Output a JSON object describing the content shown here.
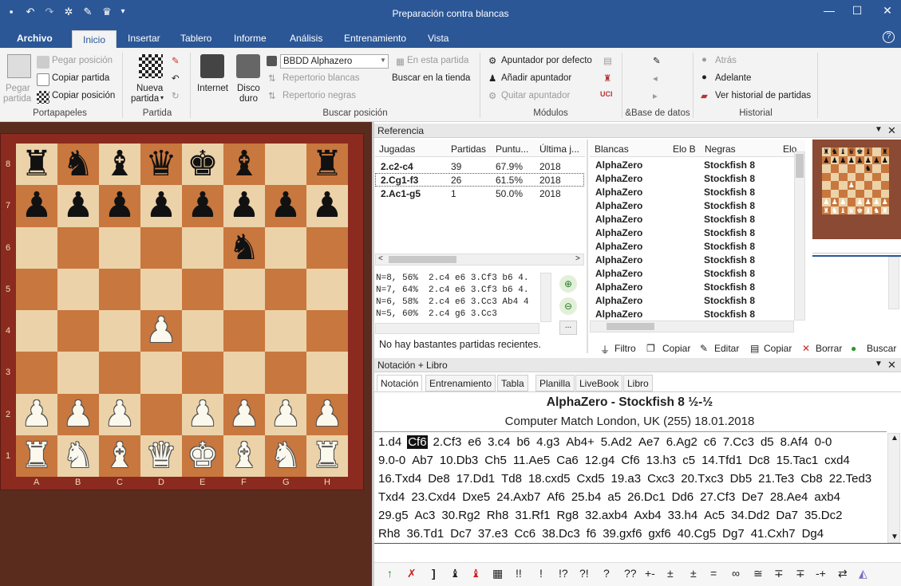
{
  "window": {
    "title": "Preparación contra blancas"
  },
  "menu": {
    "tabs": [
      "Archivo",
      "Inicio",
      "Insertar",
      "Tablero",
      "Informe",
      "Análisis",
      "Entrenamiento",
      "Vista"
    ],
    "active": "Inicio"
  },
  "ribbon": {
    "portapapeles": {
      "paste_big": "Pegar",
      "paste_big2": "partida",
      "paste_pos": "Pegar posición",
      "copy_game": "Copiar partida",
      "copy_pos": "Copiar posición",
      "group": "Portapapeles"
    },
    "partida": {
      "new_game": "Nueva",
      "new_game2": "partida",
      "group": "Partida"
    },
    "buscar": {
      "internet": "Internet",
      "disk": "Disco",
      "disk2": "duro",
      "db_select": "BBDD Alphazero",
      "rep_white": "Repertorio blancas",
      "rep_black": "Repertorio negras",
      "in_game": "En esta partida",
      "shop": "Buscar en la tienda",
      "group": "Buscar posición"
    },
    "modulos": {
      "default_engine": "Apuntador por defecto",
      "add_engine": "Añadir apuntador",
      "remove_engine": "Quitar apuntador",
      "group": "Módulos"
    },
    "base": {
      "group": "&Base de datos"
    },
    "historial": {
      "back": "Atrás",
      "forward": "Adelante",
      "history": "Ver historial de partidas",
      "group": "Historial"
    }
  },
  "board": {
    "files": [
      "A",
      "B",
      "C",
      "D",
      "E",
      "F",
      "G",
      "H"
    ],
    "ranks": [
      "8",
      "7",
      "6",
      "5",
      "4",
      "3",
      "2",
      "1"
    ],
    "position": [
      [
        "br",
        "bn",
        "bb",
        "bq",
        "bk",
        "bb",
        "",
        "br"
      ],
      [
        "bp",
        "bp",
        "bp",
        "bp",
        "bp",
        "bp",
        "bp",
        "bp"
      ],
      [
        "",
        "",
        "",
        "",
        "",
        "bn",
        "",
        ""
      ],
      [
        "",
        "",
        "",
        "",
        "",
        "",
        "",
        ""
      ],
      [
        "",
        "",
        "",
        "wp",
        "",
        "",
        "",
        ""
      ],
      [
        "",
        "",
        "",
        "",
        "",
        "",
        "",
        ""
      ],
      [
        "wp",
        "wp",
        "wp",
        "",
        "wp",
        "wp",
        "wp",
        "wp"
      ],
      [
        "wr",
        "wn",
        "wb",
        "wq",
        "wk",
        "wb",
        "wn",
        "wr"
      ]
    ]
  },
  "reference": {
    "title": "Referencia",
    "moves_headers": [
      "Jugadas",
      "Partidas",
      "Puntu...",
      "Última j..."
    ],
    "moves": [
      {
        "move": "2.c2-c4",
        "games": "39",
        "score": "67.9%",
        "last": "2018"
      },
      {
        "move": "2.Cg1-f3",
        "games": "26",
        "score": "61.5%",
        "last": "2018"
      },
      {
        "move": "2.Ac1-g5",
        "games": "1",
        "score": "50.0%",
        "last": "2018"
      }
    ],
    "engine_lines": [
      "N=8, 56%  2.c4 e6 3.Cf3 b6 4.",
      "N=7, 64%  2.c4 e6 3.Cf3 b6 4.",
      "N=6, 58%  2.c4 e6 3.Cc3 Ab4 4",
      "N=5, 60%  2.c4 g6 3.Cc3"
    ],
    "status": "No hay bastantes partidas recientes.",
    "games_headers": [
      "Blancas",
      "Elo B",
      "Negras",
      "Elo"
    ],
    "games": [
      [
        "AlphaZero",
        "Stockfish 8"
      ],
      [
        "AlphaZero",
        "Stockfish 8"
      ],
      [
        "AlphaZero",
        "Stockfish 8"
      ],
      [
        "AlphaZero",
        "Stockfish 8"
      ],
      [
        "AlphaZero",
        "Stockfish 8"
      ],
      [
        "AlphaZero",
        "Stockfish 8"
      ],
      [
        "AlphaZero",
        "Stockfish 8"
      ],
      [
        "AlphaZero",
        "Stockfish 8"
      ],
      [
        "AlphaZero",
        "Stockfish 8"
      ],
      [
        "AlphaZero",
        "Stockfish 8"
      ],
      [
        "AlphaZero",
        "Stockfish 8"
      ],
      [
        "AlphaZero",
        "Stockfish 8"
      ]
    ],
    "toolbar": {
      "filter": "Filtro",
      "copy1": "Copiar",
      "edit": "Editar",
      "copy2": "Copiar",
      "delete": "Borrar",
      "search": "Buscar"
    }
  },
  "notation": {
    "title": "Notación + Libro",
    "tabs": [
      "Notación",
      "Entrenamiento",
      "Tabla",
      "Planilla",
      "LiveBook",
      "Libro"
    ],
    "game_title": "AlphaZero - Stockfish 8  ½-½",
    "event": "Computer Match London, UK (255) 18.01.2018",
    "lines": [
      [
        "1.d4",
        "Cf6",
        "2.Cf3",
        "e6",
        "3.c4",
        "b6",
        "4.g3",
        "Ab4+",
        "5.Ad2",
        "Ae7",
        "6.Ag2",
        "c6",
        "7.Cc3",
        "d5",
        "8.Af4",
        "0-0"
      ],
      [
        "9.0-0",
        "Ab7",
        "10.Db3",
        "Ch5",
        "11.Ae5",
        "Ca6",
        "12.g4",
        "Cf6",
        "13.h3",
        "c5",
        "14.Tfd1",
        "Dc8",
        "15.Tac1",
        "cxd4"
      ],
      [
        "16.Txd4",
        "De8",
        "17.Dd1",
        "Td8",
        "18.cxd5",
        "Cxd5",
        "19.a3",
        "Cxc3",
        "20.Txc3",
        "Db5",
        "21.Te3",
        "Cb8",
        "22.Ted3"
      ],
      [
        "Txd4",
        "23.Cxd4",
        "Dxe5",
        "24.Axb7",
        "Af6",
        "25.b4",
        "a5",
        "26.Dc1",
        "Dd6",
        "27.Cf3",
        "De7",
        "28.Ae4",
        "axb4"
      ],
      [
        "29.g5",
        "Ac3",
        "30.Rg2",
        "Rh8",
        "31.Rf1",
        "Rg8",
        "32.axb4",
        "Axb4",
        "33.h4",
        "Ac5",
        "34.Dd2",
        "Da7",
        "35.Dc2"
      ],
      [
        "Rh8",
        "36.Td1",
        "Dc7",
        "37.e3",
        "Cc6",
        "38.Dc3",
        "f6",
        "39.gxf6",
        "gxf6",
        "40.Cg5",
        "Dg7",
        "41.Cxh7",
        "Dg4"
      ]
    ],
    "current_move": "Cf6",
    "symbols": [
      "!!",
      "!",
      "!?",
      "?!",
      "?",
      "??",
      "+-",
      "±",
      "±",
      "=",
      "∞",
      "≅",
      "∓",
      "∓",
      "-+",
      "⇄"
    ]
  }
}
